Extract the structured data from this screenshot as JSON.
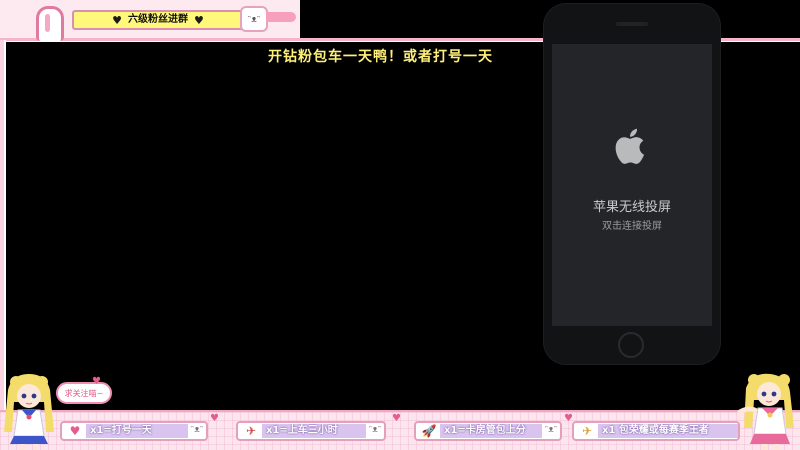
{
  "header": {
    "title": "六级粉丝进群",
    "cat_face": "ᵔᴥᵔ"
  },
  "announcement": "开钻粉包车一天鸭！或者打号一天",
  "phone": {
    "screen_title": "苹果无线投屏",
    "screen_subtitle": "双击连接投屏"
  },
  "speech_bubble": "求关注喵~",
  "gifts": [
    {
      "icon": "gift-heart-icon",
      "glyph": "♥",
      "label": "x1=打号一天"
    },
    {
      "icon": "rocket-icon",
      "glyph": "✈",
      "label": "x1=上车三小时"
    },
    {
      "icon": "rocket-icon",
      "glyph": "🚀",
      "label": "x1=卡房管包上分"
    },
    {
      "icon": "plane-icon",
      "glyph": "✈",
      "label": "x1 包荣耀或每赛季王者"
    }
  ],
  "colors": {
    "frame_pink": "#f3a6c0",
    "title_yellow": "#fff87a",
    "announce_yellow": "#fff07a",
    "accent_pink": "#e35d8e"
  }
}
